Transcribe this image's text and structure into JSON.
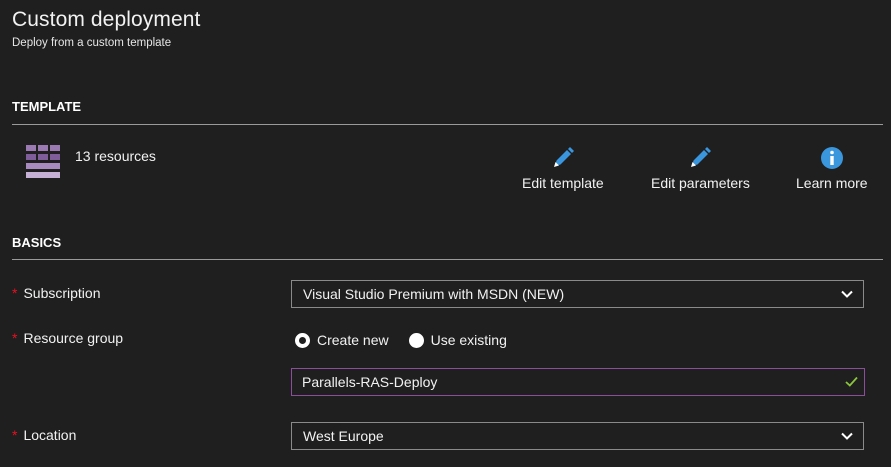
{
  "header": {
    "title": "Custom deployment",
    "subtitle": "Deploy from a custom template"
  },
  "template_section": {
    "header": "TEMPLATE",
    "resources_text": "13 resources",
    "actions": [
      {
        "label": "Edit template",
        "icon": "pencil-icon"
      },
      {
        "label": "Edit parameters",
        "icon": "pencil-icon"
      },
      {
        "label": "Learn more",
        "icon": "info-icon"
      }
    ]
  },
  "basics_section": {
    "header": "BASICS",
    "required_mark": "*",
    "subscription": {
      "label": "Subscription",
      "value": "Visual Studio Premium with MSDN (NEW)"
    },
    "resource_group": {
      "label": "Resource group",
      "option_new": "Create new",
      "option_existing": "Use existing",
      "selected": "Create new",
      "value": "Parallels-RAS-Deploy"
    },
    "location": {
      "label": "Location",
      "value": "West Europe"
    }
  },
  "colors": {
    "background": "#1f1f1f",
    "accent_blue": "#3a96dd",
    "purple": "#8c5ba0",
    "required_red": "#e81123",
    "valid_green": "#8cc63e"
  }
}
